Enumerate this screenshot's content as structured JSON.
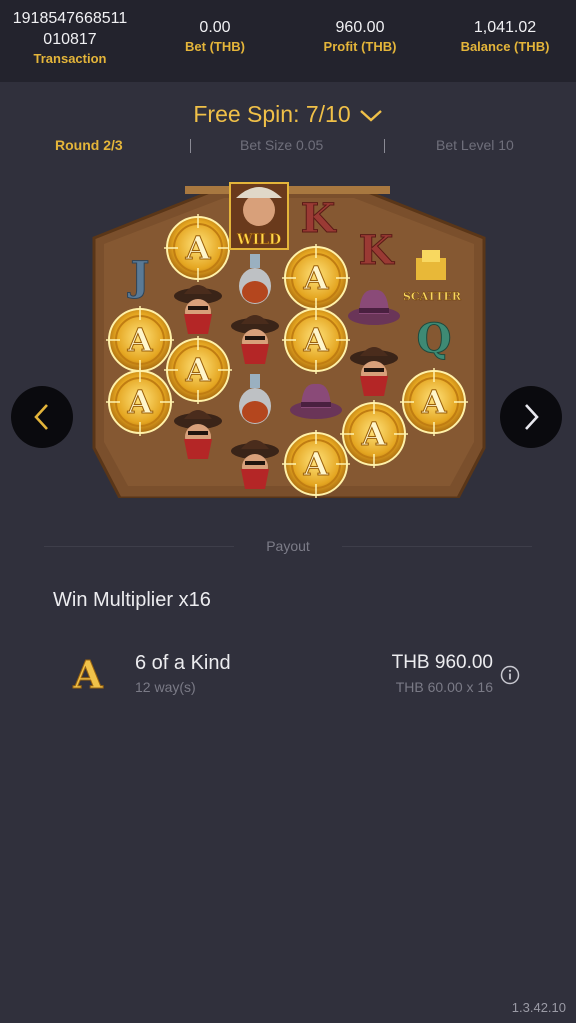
{
  "header": {
    "transaction": {
      "value": "1918547668511\n010817",
      "line1": "1918547668511",
      "line2": "010817",
      "label": "Transaction"
    },
    "bet": {
      "value": "0.00",
      "label": "Bet (THB)"
    },
    "profit": {
      "value": "960.00",
      "label": "Profit (THB)"
    },
    "balance": {
      "value": "1,041.02",
      "label": "Balance (THB)"
    }
  },
  "free_spin": {
    "title": "Free Spin: 7/10"
  },
  "round_info": {
    "round": "Round 2/3",
    "bet_size": "Bet Size 0.05",
    "bet_level": "Bet Level 10"
  },
  "board": {
    "wild_label": "WILD",
    "scatter_label": "SCATTER",
    "symbols": [
      "A",
      "J",
      "K",
      "Q",
      "wild",
      "scatter",
      "bandit",
      "hat",
      "bottle"
    ]
  },
  "payout": {
    "divider_label": "Payout",
    "multiplier": "Win Multiplier x16",
    "rows": [
      {
        "symbol": "A",
        "kind": "6 of a Kind",
        "ways": "12 way(s)",
        "amount": "THB 960.00",
        "calc": "THB 60.00 x 16"
      }
    ]
  },
  "version": "1.3.42.10",
  "colors": {
    "accent": "#e4b53a",
    "background": "#30303c",
    "topbar": "#23232d"
  },
  "icons": [
    "chevron-down-icon",
    "arrow-left-icon",
    "arrow-right-icon",
    "info-icon"
  ]
}
